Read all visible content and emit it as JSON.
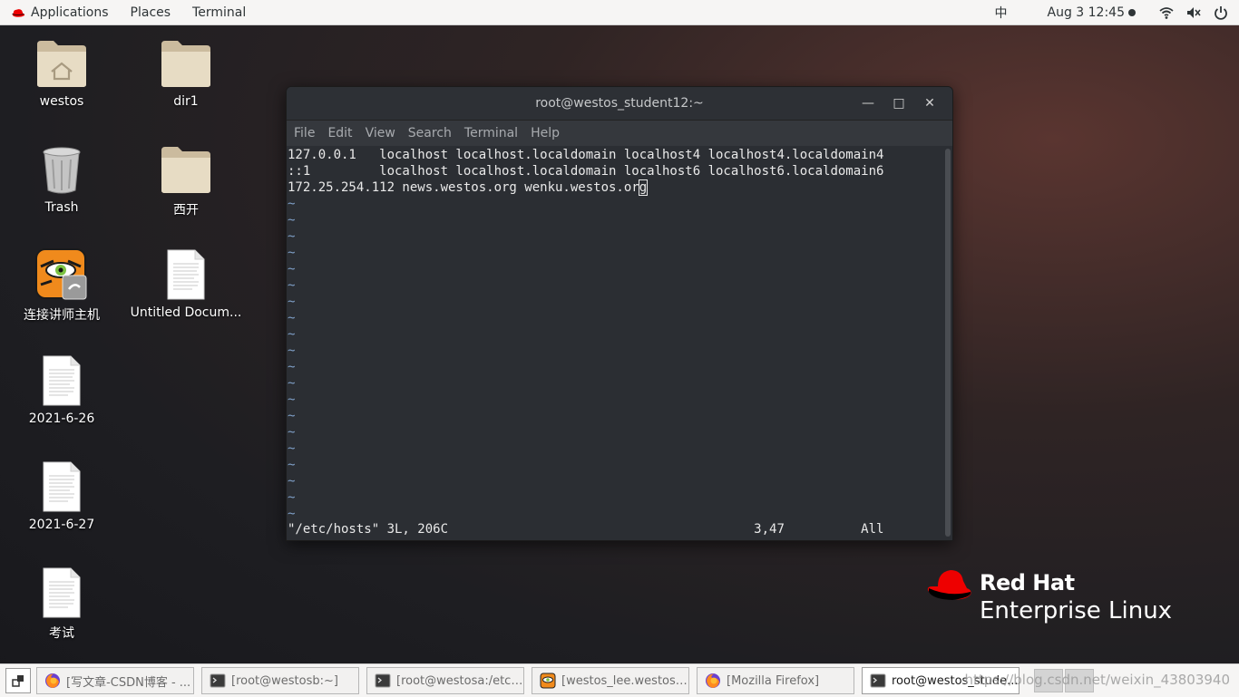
{
  "topbar": {
    "menu": [
      "Applications",
      "Places",
      "Terminal"
    ],
    "ime": "中",
    "clock": "Aug 3  12:45"
  },
  "desktop": {
    "icons": [
      {
        "label": "westos",
        "icon": "home-folder-icon"
      },
      {
        "label": "dir1",
        "icon": "folder-icon"
      },
      {
        "label": "Trash",
        "icon": "trash-icon"
      },
      {
        "label": "西开",
        "icon": "folder-icon"
      },
      {
        "label": "连接讲师主机",
        "icon": "remote-viewer-icon"
      },
      {
        "label": "Untitled Docum...",
        "icon": "document-icon"
      },
      {
        "label": "2021-6-26",
        "icon": "document-icon"
      },
      {
        "label": "2021-6-27",
        "icon": "document-icon"
      },
      {
        "label": "考试",
        "icon": "document-icon"
      }
    ]
  },
  "terminal": {
    "title": "root@westos_student12:~",
    "menu": [
      "File",
      "Edit",
      "View",
      "Search",
      "Terminal",
      "Help"
    ],
    "lines": [
      "127.0.0.1   localhost localhost.localdomain localhost4 localhost4.localdomain4",
      "::1         localhost localhost.localdomain localhost6 localhost6.localdomain6",
      "172.25.254.112 news.westos.org wenku.westos.or"
    ],
    "cursor_char": "g",
    "tilde": "~",
    "tilde_count": 20,
    "status": "\"/etc/hosts\" 3L, 206C                                        3,47          All"
  },
  "logo": {
    "brand": "Red Hat",
    "product": "Enterprise Linux"
  },
  "taskbar": {
    "items": [
      {
        "label": "[写文章-CSDN博客 - ...",
        "icon": "firefox-icon",
        "active": false
      },
      {
        "label": "[root@westosb:~]",
        "icon": "terminal-icon",
        "active": false
      },
      {
        "label": "[root@westosa:/etc/...",
        "icon": "terminal-icon",
        "active": false
      },
      {
        "label": "[westos_lee.westos....",
        "icon": "remote-viewer-icon",
        "active": false
      },
      {
        "label": "[Mozilla Firefox]",
        "icon": "firefox-icon",
        "active": false
      },
      {
        "label": "root@westos_stude...",
        "icon": "terminal-icon",
        "active": true
      }
    ],
    "watermark": "https://blog.csdn.net/weixin_43803940"
  },
  "colors": {
    "redhat_red": "#ee0000",
    "terminal_bg": "#2b2e33",
    "tilde": "#7fa0c8"
  }
}
